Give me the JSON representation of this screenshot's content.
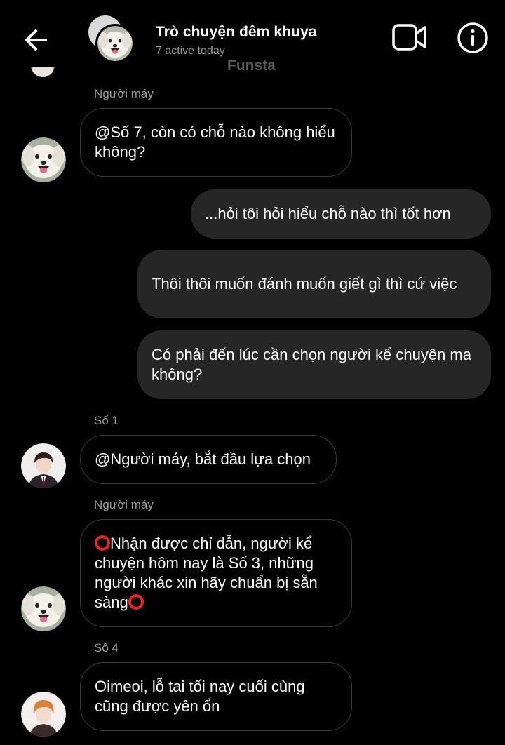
{
  "header": {
    "title": "Trò chuyện đêm khuya",
    "subtitle": "7 active today",
    "watermark": "Funsta"
  },
  "messages": [
    {
      "sender": "Người máy",
      "text": "@Số 7, còn có chỗ nào không hiểu không?"
    },
    {
      "text": "...hỏi tôi hỏi hiểu chỗ nào thì tốt hơn"
    },
    {
      "text": "Thôi thôi muốn đánh muốn giết gì thì cứ việc"
    },
    {
      "text": "Có phải đến lúc cần chọn người kể chuyện ma không?"
    },
    {
      "sender": "Số 1",
      "text": "@Người máy, bắt đầu lựa chọn"
    },
    {
      "sender": "Người máy",
      "text": "Nhận được chỉ dẫn, người kể chuyện hôm nay là Số 3, những người khác xin hãy chuẩn bị sẵn sàng"
    },
    {
      "sender": "Số 4",
      "text": "Oimeoi, lỗ tai tối nay cuối cùng cũng được yên ổn"
    }
  ],
  "icons": {
    "back": "arrow-left-icon",
    "video": "video-camera-icon",
    "info": "info-icon",
    "emoji": "hollow-red-circle-emoji"
  },
  "colors": {
    "background": "#000000",
    "outgoing_bubble": "#262626",
    "incoming_border": "#3a3a3a",
    "meta_text": "#9a9a9a",
    "emoji_red": "#e22222"
  }
}
